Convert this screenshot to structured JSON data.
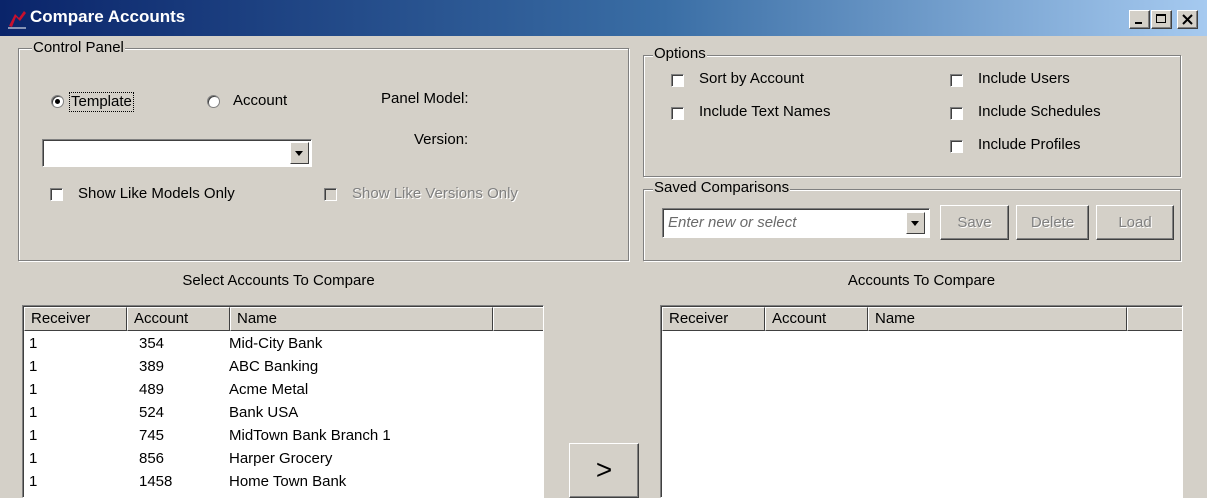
{
  "window": {
    "title": "Compare Accounts",
    "minimize": "_",
    "maximize": "□",
    "close": "✕"
  },
  "control_panel": {
    "label": "Control Panel",
    "radio_template": "Template",
    "radio_account": "Account",
    "selected": "Template",
    "panel_model_label": "Panel Model:",
    "version_label": "Version:",
    "combo_value": "",
    "show_like_models": "Show Like Models Only",
    "show_like_versions": "Show Like Versions Only"
  },
  "options": {
    "label": "Options",
    "sort_by_account": "Sort by Account",
    "include_text_names": "Include Text Names",
    "include_users": "Include Users",
    "include_schedules": "Include Schedules",
    "include_profiles": "Include Profiles"
  },
  "saved_comparisons": {
    "label": "Saved Comparisons",
    "placeholder": "Enter new or select",
    "save": "Save",
    "delete": "Delete",
    "load": "Load"
  },
  "select_list": {
    "heading": "Select Accounts To Compare",
    "columns": [
      "Receiver",
      "Account",
      "Name"
    ],
    "rows": [
      [
        "1",
        "354",
        "Mid-City Bank"
      ],
      [
        "1",
        "389",
        "ABC Banking"
      ],
      [
        "1",
        "489",
        "Acme Metal"
      ],
      [
        "1",
        "524",
        "Bank USA"
      ],
      [
        "1",
        "745",
        "MidTown Bank Branch 1"
      ],
      [
        "1",
        "856",
        "Harper Grocery"
      ],
      [
        "1",
        "1458",
        "Home Town Bank"
      ]
    ]
  },
  "move_button": ">",
  "compare_list": {
    "heading": "Accounts To Compare",
    "columns": [
      "Receiver",
      "Account",
      "Name"
    ],
    "rows": []
  },
  "colors": {
    "face": "#d4d0c8",
    "title_start": "#0a246a",
    "title_end": "#a6caf0"
  }
}
